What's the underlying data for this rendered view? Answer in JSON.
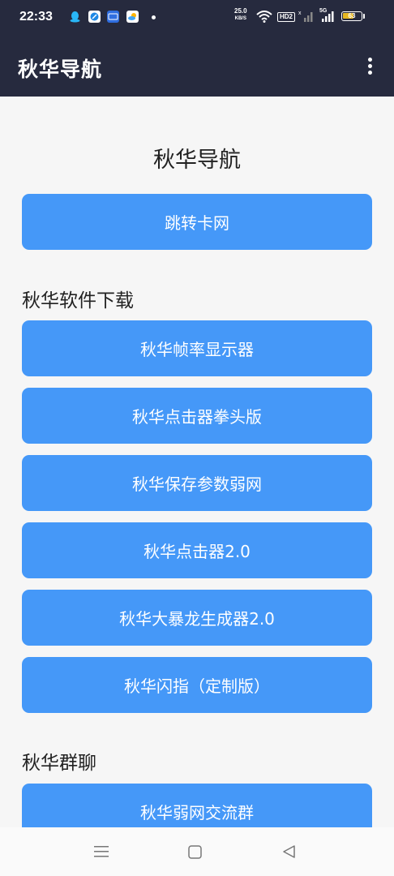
{
  "status_bar": {
    "time": "22:33",
    "net_speed_value": "25.0",
    "net_speed_unit": "KB/S",
    "hd_label": "HD2",
    "sim2_label": "5G",
    "battery_level": "63",
    "icons": [
      "qq-icon",
      "browser-icon",
      "app-123-icon",
      "weather-icon",
      "wifi-icon",
      "signal-icon",
      "battery-icon"
    ]
  },
  "app_bar": {
    "title": "秋华导航",
    "menu_icon": "more-vert-icon"
  },
  "main": {
    "heading": "秋华导航",
    "top_button": "跳转卡网",
    "sections": [
      {
        "title": "秋华软件下载",
        "buttons": [
          "秋华帧率显示器",
          "秋华点击器拳头版",
          "秋华保存参数弱网",
          "秋华点击器2.0",
          "秋华大暴龙生成器2.0",
          "秋华闪指（定制版）"
        ]
      },
      {
        "title": "秋华群聊",
        "buttons": [
          "秋华弱网交流群"
        ]
      }
    ]
  },
  "nav_bar": {
    "icons": [
      "menu-icon",
      "home-icon",
      "back-icon"
    ]
  },
  "colors": {
    "app_bar": "#262a3e",
    "button": "#4598f8",
    "background": "#f6f6f6"
  }
}
